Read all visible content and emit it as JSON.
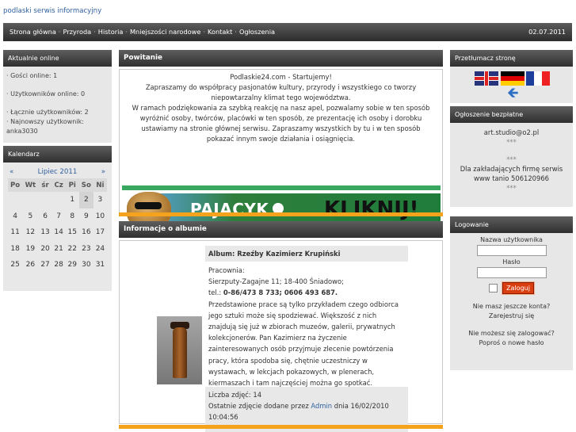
{
  "site": {
    "title": "podlaski serwis informacyjny"
  },
  "nav": {
    "items": [
      "Strona główna",
      "Przyroda",
      "Historia",
      "Mniejszości narodowe",
      "Kontakt",
      "Ogłoszenia"
    ],
    "date": "02.07.2011"
  },
  "online": {
    "title": "Aktualnie online",
    "guests": "· Gości online: 1",
    "users": "· Użytkowników online: 0",
    "total": "· Łącznie użytkowników: 2",
    "newest": "· Najnowszy użytkownik: anka3030"
  },
  "calendar": {
    "title": "Kalendarz",
    "prev": "«",
    "next": "»",
    "month": "Lipiec 2011",
    "weekdays": [
      "Po",
      "Wt",
      "śr",
      "Cz",
      "Pi",
      "So",
      "Ni"
    ],
    "weeks": [
      [
        "",
        "",
        "",
        "",
        "1",
        "2",
        "3"
      ],
      [
        "4",
        "5",
        "6",
        "7",
        "8",
        "9",
        "10"
      ],
      [
        "11",
        "12",
        "13",
        "14",
        "15",
        "16",
        "17"
      ],
      [
        "18",
        "19",
        "20",
        "21",
        "22",
        "23",
        "24"
      ],
      [
        "25",
        "26",
        "27",
        "28",
        "29",
        "30",
        "31"
      ]
    ]
  },
  "welcome": {
    "title": "Powitanie",
    "lines": [
      "Podlaskie24.com - Startujemy!",
      "Zapraszamy do współpracy pasjonatów kultury, przyrody i wszystkiego co tworzy niepowtarzalny klimat tego województwa.",
      "W ramach podziękowania za szybką reakcję na nasz apel, pozwalamy sobie w ten sposób wyróżnić osoby, twórców, placówki w ten sposób, ze prezentację ich osoby i dorobku ustawiamy na stronie głównej serwisu. Zapraszamy wszystkich by tu i w ten sposób pokazać innym swoje działania i osiągnięcia."
    ]
  },
  "banner": {
    "text1": "PAJACYK",
    "text2": "KLIKNIJ!"
  },
  "album": {
    "title": "Informacje o albumie",
    "name": "Album: Rzeźby Kazimierz Krupiński",
    "p1": "Pracownia:",
    "p2": "Sierzputy-Zagajne 11; 18-400 Śniadowo;",
    "tel_label": "tel.: ",
    "tel": "0-86/473 8 733; 0606 493 687.",
    "desc": "Przedstawione prace są tylko przykładem czego odbiorca jego sztuki może się spodziewać. Większość z nich znajdują się już w zbiorach muzeów, galerii, prywatnych kolekcjonerów. Pan Kazimierz na życzenie zainteresowanych osób przyjmuje zlecenie powtórzenia pracy, która spodoba się, chętnie uczestniczy w wystawach, w lekcjach pokazowych, w plenerach, kiermaszach i tam najczęściej można go spotkać.",
    "count": "Liczba zdjęć: 14",
    "last_prefix": "Ostatnie zdjęcie dodane przez ",
    "last_user": "Admin",
    "last_suffix": " dnia 16/02/2010 10:04:56"
  },
  "translator": {
    "title": "Przetłumacz stronę"
  },
  "ads": {
    "title": "Ogłoszenie bezpłatne",
    "line1": "art.studio@o2.pl",
    "stars": "***",
    "line2": "Dla zakładających firmę serwis www tanio 506120966"
  },
  "login": {
    "title": "Logowanie",
    "user_label": "Nazwa użytkownika",
    "pass_label": "Hasło",
    "button": "Zaloguj",
    "no_account": "Nie masz jeszcze konta?",
    "register": "Zarejestruj się",
    "cant_login": "Nie możesz się zalogować?",
    "new_pass": "Poproś o nowe hasło"
  }
}
